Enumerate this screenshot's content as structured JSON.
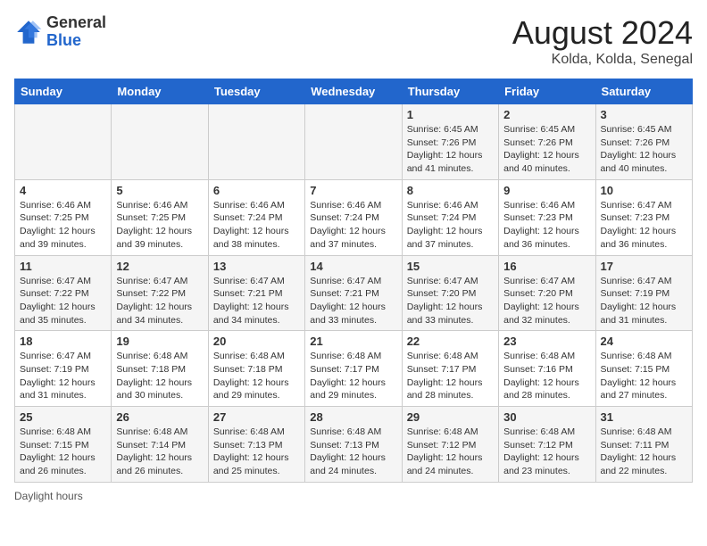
{
  "logo": {
    "text_general": "General",
    "text_blue": "Blue"
  },
  "title": "August 2024",
  "subtitle": "Kolda, Kolda, Senegal",
  "days_of_week": [
    "Sunday",
    "Monday",
    "Tuesday",
    "Wednesday",
    "Thursday",
    "Friday",
    "Saturday"
  ],
  "weeks": [
    [
      {
        "day": "",
        "info": ""
      },
      {
        "day": "",
        "info": ""
      },
      {
        "day": "",
        "info": ""
      },
      {
        "day": "",
        "info": ""
      },
      {
        "day": "1",
        "info": "Sunrise: 6:45 AM\nSunset: 7:26 PM\nDaylight: 12 hours and 41 minutes."
      },
      {
        "day": "2",
        "info": "Sunrise: 6:45 AM\nSunset: 7:26 PM\nDaylight: 12 hours and 40 minutes."
      },
      {
        "day": "3",
        "info": "Sunrise: 6:45 AM\nSunset: 7:26 PM\nDaylight: 12 hours and 40 minutes."
      }
    ],
    [
      {
        "day": "4",
        "info": "Sunrise: 6:46 AM\nSunset: 7:25 PM\nDaylight: 12 hours and 39 minutes."
      },
      {
        "day": "5",
        "info": "Sunrise: 6:46 AM\nSunset: 7:25 PM\nDaylight: 12 hours and 39 minutes."
      },
      {
        "day": "6",
        "info": "Sunrise: 6:46 AM\nSunset: 7:24 PM\nDaylight: 12 hours and 38 minutes."
      },
      {
        "day": "7",
        "info": "Sunrise: 6:46 AM\nSunset: 7:24 PM\nDaylight: 12 hours and 37 minutes."
      },
      {
        "day": "8",
        "info": "Sunrise: 6:46 AM\nSunset: 7:24 PM\nDaylight: 12 hours and 37 minutes."
      },
      {
        "day": "9",
        "info": "Sunrise: 6:46 AM\nSunset: 7:23 PM\nDaylight: 12 hours and 36 minutes."
      },
      {
        "day": "10",
        "info": "Sunrise: 6:47 AM\nSunset: 7:23 PM\nDaylight: 12 hours and 36 minutes."
      }
    ],
    [
      {
        "day": "11",
        "info": "Sunrise: 6:47 AM\nSunset: 7:22 PM\nDaylight: 12 hours and 35 minutes."
      },
      {
        "day": "12",
        "info": "Sunrise: 6:47 AM\nSunset: 7:22 PM\nDaylight: 12 hours and 34 minutes."
      },
      {
        "day": "13",
        "info": "Sunrise: 6:47 AM\nSunset: 7:21 PM\nDaylight: 12 hours and 34 minutes."
      },
      {
        "day": "14",
        "info": "Sunrise: 6:47 AM\nSunset: 7:21 PM\nDaylight: 12 hours and 33 minutes."
      },
      {
        "day": "15",
        "info": "Sunrise: 6:47 AM\nSunset: 7:20 PM\nDaylight: 12 hours and 33 minutes."
      },
      {
        "day": "16",
        "info": "Sunrise: 6:47 AM\nSunset: 7:20 PM\nDaylight: 12 hours and 32 minutes."
      },
      {
        "day": "17",
        "info": "Sunrise: 6:47 AM\nSunset: 7:19 PM\nDaylight: 12 hours and 31 minutes."
      }
    ],
    [
      {
        "day": "18",
        "info": "Sunrise: 6:47 AM\nSunset: 7:19 PM\nDaylight: 12 hours and 31 minutes."
      },
      {
        "day": "19",
        "info": "Sunrise: 6:48 AM\nSunset: 7:18 PM\nDaylight: 12 hours and 30 minutes."
      },
      {
        "day": "20",
        "info": "Sunrise: 6:48 AM\nSunset: 7:18 PM\nDaylight: 12 hours and 29 minutes."
      },
      {
        "day": "21",
        "info": "Sunrise: 6:48 AM\nSunset: 7:17 PM\nDaylight: 12 hours and 29 minutes."
      },
      {
        "day": "22",
        "info": "Sunrise: 6:48 AM\nSunset: 7:17 PM\nDaylight: 12 hours and 28 minutes."
      },
      {
        "day": "23",
        "info": "Sunrise: 6:48 AM\nSunset: 7:16 PM\nDaylight: 12 hours and 28 minutes."
      },
      {
        "day": "24",
        "info": "Sunrise: 6:48 AM\nSunset: 7:15 PM\nDaylight: 12 hours and 27 minutes."
      }
    ],
    [
      {
        "day": "25",
        "info": "Sunrise: 6:48 AM\nSunset: 7:15 PM\nDaylight: 12 hours and 26 minutes."
      },
      {
        "day": "26",
        "info": "Sunrise: 6:48 AM\nSunset: 7:14 PM\nDaylight: 12 hours and 26 minutes."
      },
      {
        "day": "27",
        "info": "Sunrise: 6:48 AM\nSunset: 7:13 PM\nDaylight: 12 hours and 25 minutes."
      },
      {
        "day": "28",
        "info": "Sunrise: 6:48 AM\nSunset: 7:13 PM\nDaylight: 12 hours and 24 minutes."
      },
      {
        "day": "29",
        "info": "Sunrise: 6:48 AM\nSunset: 7:12 PM\nDaylight: 12 hours and 24 minutes."
      },
      {
        "day": "30",
        "info": "Sunrise: 6:48 AM\nSunset: 7:12 PM\nDaylight: 12 hours and 23 minutes."
      },
      {
        "day": "31",
        "info": "Sunrise: 6:48 AM\nSunset: 7:11 PM\nDaylight: 12 hours and 22 minutes."
      }
    ]
  ],
  "footer_text": "Daylight hours"
}
